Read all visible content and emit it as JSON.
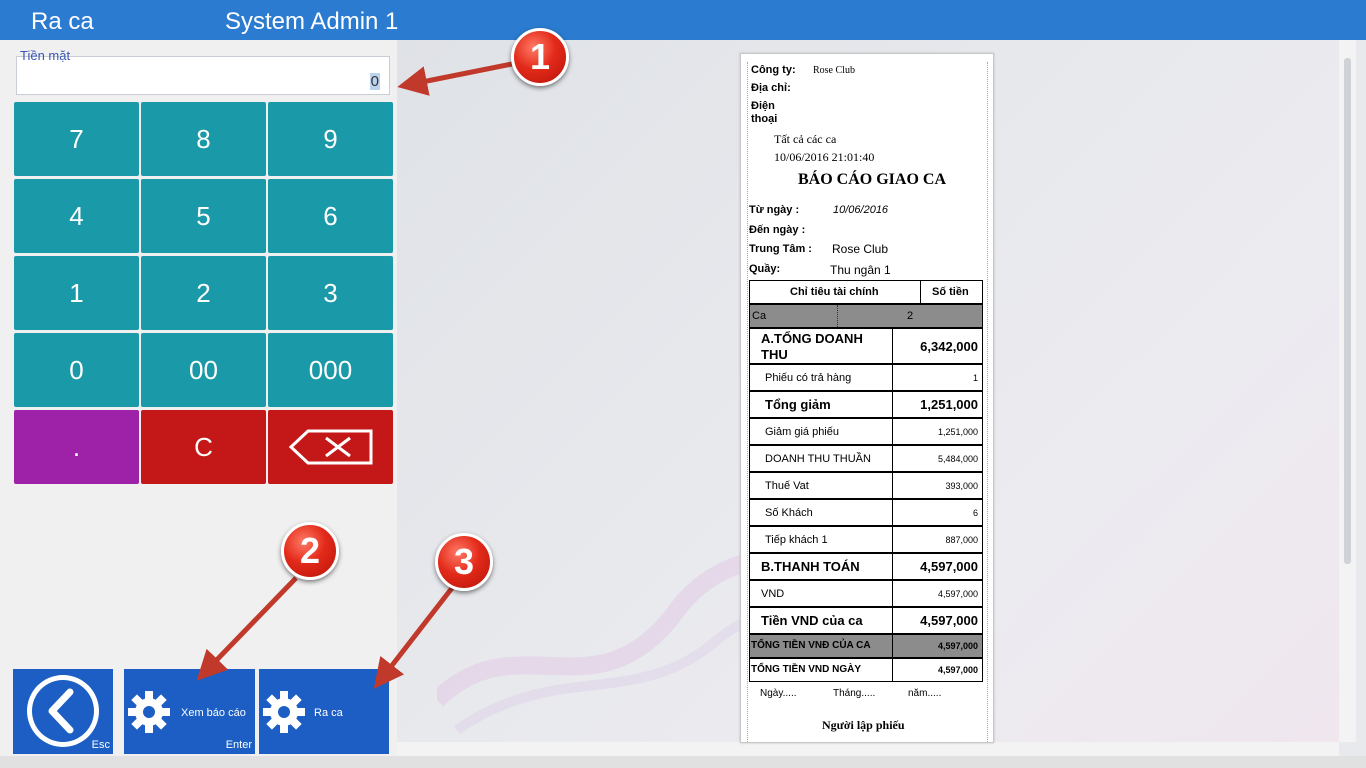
{
  "window": {
    "title": "Ra ca",
    "user": "System Admin 1"
  },
  "cash": {
    "label": "Tiền mặt",
    "value": "0"
  },
  "keypad": {
    "k7": "7",
    "k8": "8",
    "k9": "9",
    "k4": "4",
    "k5": "5",
    "k6": "6",
    "k1": "1",
    "k2": "2",
    "k3": "3",
    "k0": "0",
    "k00": "00",
    "k000": "000",
    "dot": ".",
    "clear": "C"
  },
  "actions": {
    "back_shortcut": "Esc",
    "view_report": "Xem báo cáo",
    "view_report_shortcut": "Enter",
    "shift_out": "Ra ca"
  },
  "report": {
    "company_label": "Công ty:",
    "company": "Rose Club",
    "address_label": "Địa chỉ:",
    "phone_label": "Điện thoại",
    "all_shifts": "Tất cả các ca",
    "printed_at": "10/06/2016 21:01:40",
    "title": "BÁO CÁO GIAO CA",
    "from_label": "Từ ngày :",
    "from": "10/06/2016",
    "to_label": "Đến ngày :",
    "center_label": "Trung Tâm :",
    "center": "Rose Club",
    "counter_label": "Quầy:",
    "counter": "Thu ngân 1",
    "col_item": "Chỉ tiêu tài chính",
    "col_amount": "Số tiền",
    "shift_label": "Ca",
    "shift_no": "2",
    "rows": [
      {
        "label": "A.TỔNG DOANH THU",
        "value": "6,342,000"
      },
      {
        "label": "Phiếu có trả hàng",
        "value": "1"
      },
      {
        "label": "Tổng giảm",
        "value": "1,251,000"
      },
      {
        "label": "Giảm giá phiếu",
        "value": "1,251,000"
      },
      {
        "label": "DOANH THU THUẦN",
        "value": "5,484,000"
      },
      {
        "label": "Thuế Vat",
        "value": "393,000"
      },
      {
        "label": "Số Khách",
        "value": "6"
      },
      {
        "label": "Tiếp khách 1",
        "value": "887,000"
      },
      {
        "label": "B.THANH TOÁN",
        "value": "4,597,000"
      },
      {
        "label": "VND",
        "value": "4,597,000"
      },
      {
        "label": "Tiền VND của ca",
        "value": "4,597,000"
      },
      {
        "label": "TỔNG TIỀN VNĐ CỦA CA",
        "value": "4,597,000"
      },
      {
        "label": "TỔNG TIỀN VND NGÀY",
        "value": "4,597,000"
      }
    ],
    "day": "Ngày.....",
    "month": "Tháng.....",
    "year": "năm.....",
    "signer": "Người lập phiếu"
  },
  "markers": {
    "m1": "1",
    "m2": "2",
    "m3": "3"
  },
  "colors": {
    "titlebar": "#2b7bd0",
    "key_teal": "#1a99a8",
    "key_purple": "#9d22a8",
    "key_red": "#c41818",
    "button_blue": "#1c5ec3",
    "marker_red": "#e32a1a",
    "arrow": "#c0392b"
  }
}
